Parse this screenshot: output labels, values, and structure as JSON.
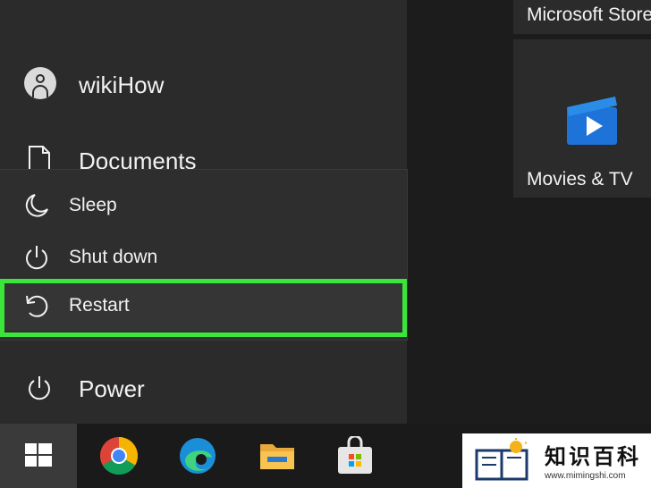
{
  "start_menu": {
    "user": {
      "label": "wikiHow"
    },
    "documents": {
      "label": "Documents"
    },
    "power": {
      "label": "Power"
    },
    "power_flyout": {
      "items": [
        {
          "label": "Sleep",
          "icon": "moon-icon"
        },
        {
          "label": "Shut down",
          "icon": "power-icon"
        },
        {
          "label": "Restart",
          "icon": "restart-icon",
          "highlighted": true
        }
      ],
      "highlight_color": "#3ae63a"
    }
  },
  "tiles": {
    "store": {
      "label": "Microsoft Store"
    },
    "movies": {
      "label": "Movies & TV"
    }
  },
  "taskbar": {
    "apps": [
      "windows-start-icon",
      "chrome-icon",
      "edge-icon",
      "file-explorer-icon",
      "microsoft-store-icon"
    ]
  },
  "watermark": {
    "title": "知识百科",
    "url": "www.mimingshi.com"
  }
}
